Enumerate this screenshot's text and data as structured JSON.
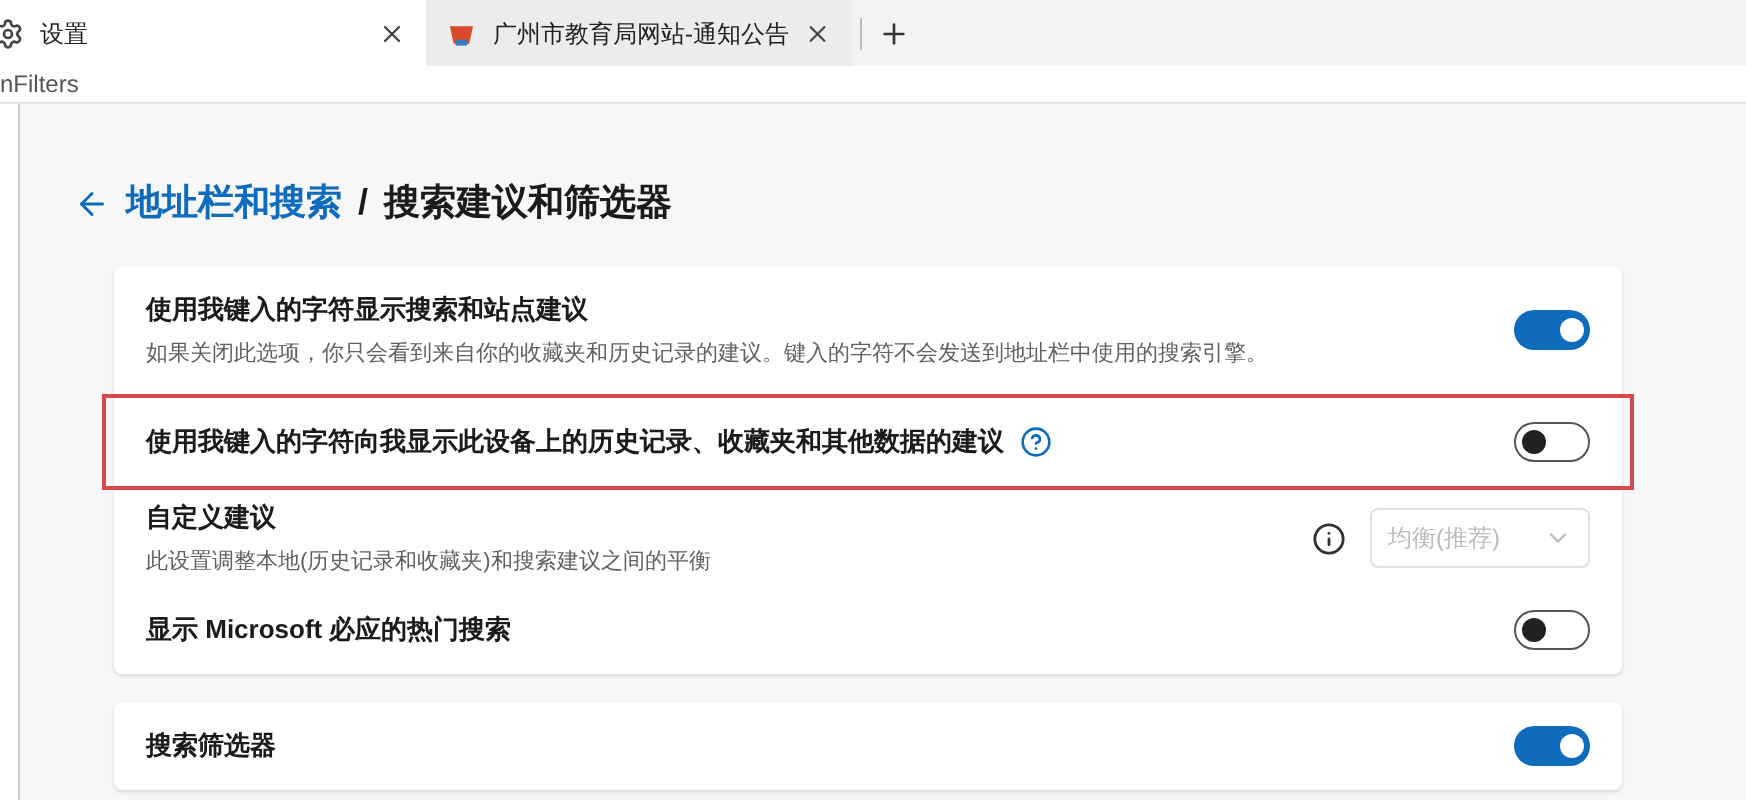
{
  "tabs": [
    {
      "label": "设置",
      "selected": true
    },
    {
      "label": "广州市教育局网站-通知公告",
      "selected": false
    }
  ],
  "address": "nFilters",
  "breadcrumb": {
    "parent": "地址栏和搜索",
    "separator": "/",
    "current": "搜索建议和筛选器"
  },
  "cards": [
    {
      "rows": [
        {
          "kind": "toggle",
          "title": "使用我键入的字符显示搜索和站点建议",
          "description": "如果关闭此选项，你只会看到来自你的收藏夹和历史记录的建议。键入的字符不会发送到地址栏中使用的搜索引擎。",
          "on": true,
          "highlighted": false,
          "help": false
        },
        {
          "kind": "toggle",
          "title": "使用我键入的字符向我显示此设备上的历史记录、收藏夹和其他数据的建议",
          "on": false,
          "highlighted": true,
          "help": true
        },
        {
          "kind": "dropdown",
          "title": "自定义建议",
          "description": "此设置调整本地(历史记录和收藏夹)和搜索建议之间的平衡",
          "value": "均衡(推荐)",
          "disabled": true
        },
        {
          "kind": "toggle",
          "title": "显示 Microsoft 必应的热门搜索",
          "on": false,
          "highlighted": false,
          "help": false
        }
      ]
    },
    {
      "rows": [
        {
          "kind": "toggle",
          "title": "搜索筛选器",
          "on": true,
          "highlighted": false,
          "help": false
        }
      ]
    }
  ]
}
